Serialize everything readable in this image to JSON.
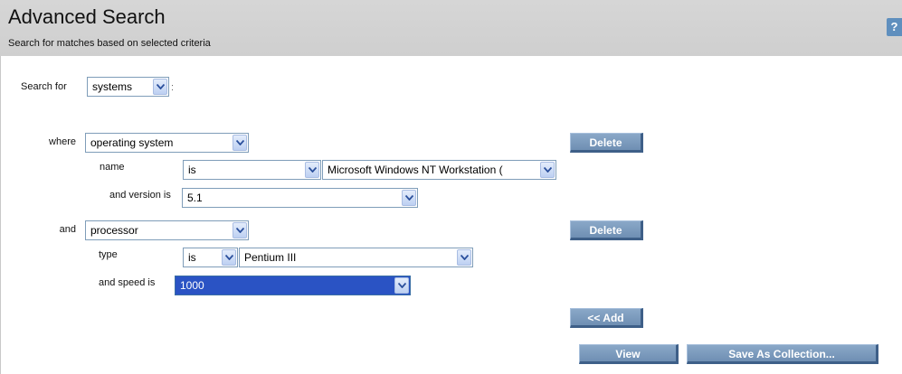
{
  "header": {
    "title": "Advanced Search",
    "subtitle": "Search for matches based on selected criteria",
    "help_label": "?"
  },
  "search_for": {
    "label": "Search for",
    "value": "systems",
    "suffix": ":"
  },
  "criteria": [
    {
      "connector": "where",
      "category": "operating system",
      "delete_label": "Delete",
      "rows": [
        {
          "label": "name",
          "operator": "is",
          "value": "Microsoft Windows NT Workstation ("
        },
        {
          "label": "and version is",
          "value": "5.1"
        }
      ]
    },
    {
      "connector": "and",
      "category": "processor",
      "delete_label": "Delete",
      "rows": [
        {
          "label": "type",
          "operator": "is",
          "value": "Pentium III"
        },
        {
          "label": "and speed is",
          "value": "1000"
        }
      ]
    }
  ],
  "actions": {
    "add_label": "<< Add",
    "view_label": "View",
    "save_label": "Save As Collection..."
  },
  "icons": {
    "dropdown": "chevron-down-icon",
    "help": "help-icon"
  },
  "colors": {
    "button": "#7896b9",
    "header": "#d3d3d3",
    "selection": "#2a53c4"
  }
}
